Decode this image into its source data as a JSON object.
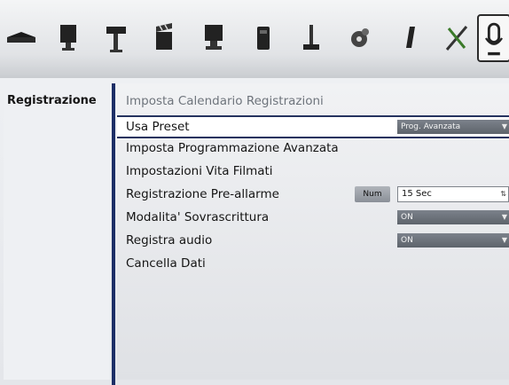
{
  "toolbar": {
    "icons": [
      "drive-icon",
      "monitor-icon",
      "camera-icon",
      "clapperboard-icon",
      "computer-icon",
      "network-icon",
      "joystick-icon",
      "gear-icon",
      "usb-icon",
      "tools-icon",
      "microphone-icon"
    ]
  },
  "left_panel": {
    "title": "Registrazione"
  },
  "right_panel": {
    "header": "Imposta Calendario Registrazioni",
    "rows": [
      {
        "label": "Usa Preset",
        "value": "Prog. Avanzata"
      },
      {
        "label": "Imposta Programmazione Avanzata"
      },
      {
        "label": "Impostazioni Vita Filmati"
      },
      {
        "label": "Registrazione Pre-allarme",
        "button": "Num",
        "value": "15 Sec"
      },
      {
        "label": "Modalita' Sovrascrittura",
        "value": "ON"
      },
      {
        "label": "Registra audio",
        "value": "ON"
      },
      {
        "label": "Cancella Dati"
      }
    ]
  },
  "colors": {
    "divider": "#1c2e66",
    "selection_border": "#25335f"
  }
}
